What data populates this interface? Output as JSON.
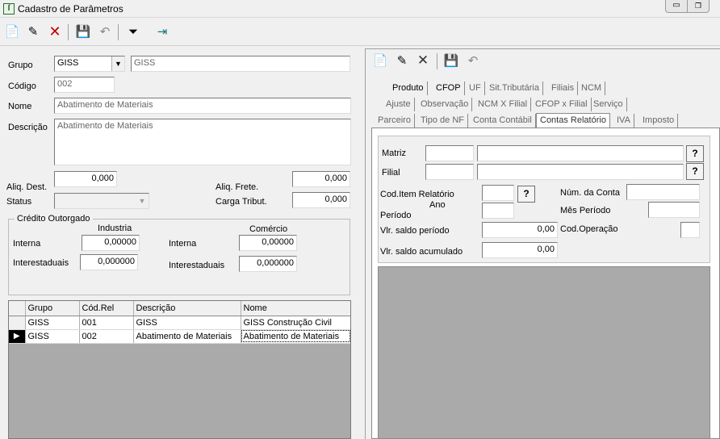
{
  "window": {
    "title": "Cadastro de Parâmetros"
  },
  "form": {
    "grupo_label": "Grupo",
    "grupo_value": "GISS",
    "grupo_desc": "GISS",
    "codigo_label": "Código",
    "codigo_value": "002",
    "nome_label": "Nome",
    "nome_value": "Abatimento de Materiais",
    "descricao_label": "Descrição",
    "descricao_value": "Abatimento de Materiais",
    "aliq_dest_label": "Aliq. Dest.",
    "aliq_dest_value": "0,000",
    "aliq_frete_label": "Aliq. Frete.",
    "aliq_frete_value": "0,000",
    "status_label": "Status",
    "carga_label": "Carga Tribut.",
    "carga_value": "0,000"
  },
  "credito": {
    "title": "Crédito Outorgado",
    "industria_header": "Industria",
    "comercio_header": "Comércio",
    "interna_label": "Interna",
    "interestaduais_label": "Interestaduais",
    "ind_interna": "0,00000",
    "ind_interestaduais": "0,000000",
    "com_interna_label": "Interna",
    "com_interestaduais_label": "Interestaduais",
    "com_interna": "0,00000",
    "com_interestaduais": "0,000000"
  },
  "grid": {
    "columns": [
      "Grupo",
      "Cód.Rel",
      "Descrição",
      "Nome"
    ],
    "rows": [
      {
        "grupo": "GISS",
        "cod": "001",
        "descricao": "GISS",
        "nome": "GISS Construção Civil"
      },
      {
        "grupo": "GISS",
        "cod": "002",
        "descricao": "Abatimento de Materiais",
        "nome": "Abatimento de Materiais"
      }
    ]
  },
  "tabs": {
    "row1": [
      "Produto",
      "CFOP",
      "UF",
      "Sit.Tributária",
      "Filiais",
      "NCM"
    ],
    "row2": [
      "Ajuste",
      "Observação",
      "NCM X Filial",
      "CFOP x Filial",
      "Serviço"
    ],
    "row3": [
      "Parceiro",
      "Tipo de NF",
      "Conta Contábil",
      "Contas Relatório",
      "IVA",
      "Imposto"
    ]
  },
  "panel": {
    "matriz_label": "Matriz",
    "filial_label": "Filial",
    "cod_item_label": "Cod.Item Relatório",
    "ano_label": "Ano",
    "periodo_label": "Período",
    "num_conta_label": "Núm. da Conta",
    "mes_periodo_label": "Mês Período",
    "vlr_saldo_periodo_label": "Vlr. saldo período",
    "vlr_saldo_periodo": "0,00",
    "cod_operacao_label": "Cod.Operação",
    "vlr_saldo_acum_label": "Vlr. saldo acumulado",
    "vlr_saldo_acum": "0,00",
    "help_button": "?"
  }
}
